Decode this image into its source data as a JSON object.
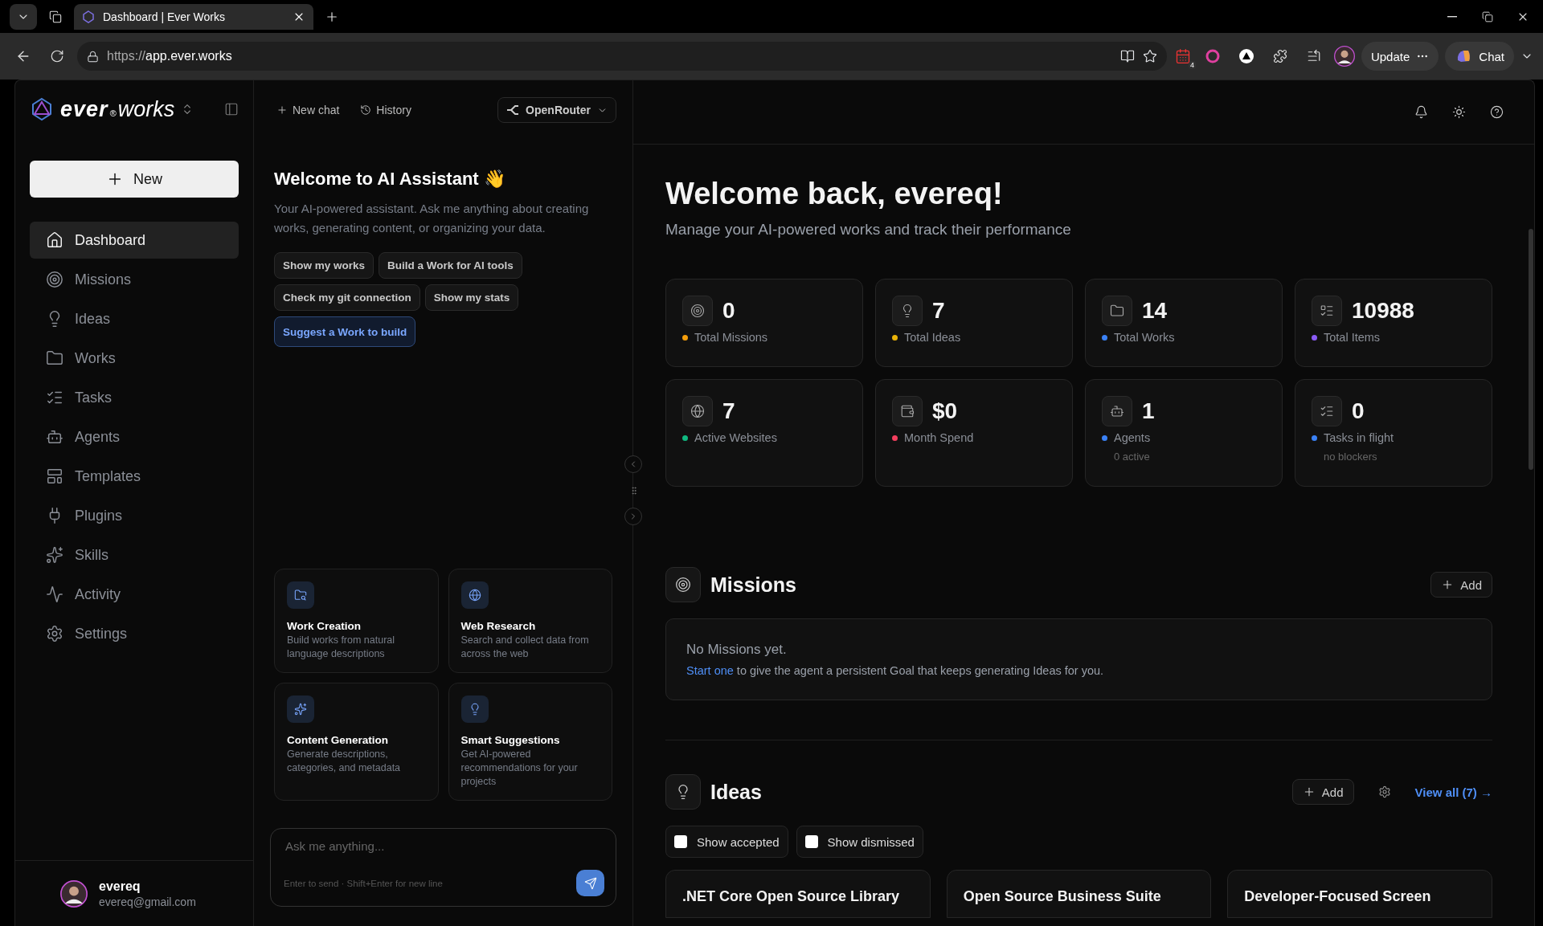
{
  "browser": {
    "tabs": [
      {
        "title": "Dashboard | Ever Works",
        "selected": true
      }
    ],
    "url_scheme": "https://",
    "url_host": "app.ever.works",
    "extension_badge": "4",
    "update_button": "Update",
    "chat_button": "Chat"
  },
  "sidebar": {
    "logo": {
      "word": "ever",
      "mark": "®",
      "suffix": "works"
    },
    "new_button": "New",
    "items": [
      {
        "label": "Dashboard",
        "selected": true
      },
      {
        "label": "Missions",
        "selected": false
      },
      {
        "label": "Ideas",
        "selected": false
      },
      {
        "label": "Works",
        "selected": false
      },
      {
        "label": "Tasks",
        "selected": false
      },
      {
        "label": "Agents",
        "selected": false
      },
      {
        "label": "Templates",
        "selected": false
      },
      {
        "label": "Plugins",
        "selected": false
      },
      {
        "label": "Skills",
        "selected": false
      },
      {
        "label": "Activity",
        "selected": false
      },
      {
        "label": "Settings",
        "selected": false
      }
    ],
    "user": {
      "name": "evereq",
      "email": "evereq@gmail.com"
    }
  },
  "chat": {
    "new_chat": "New chat",
    "history": "History",
    "model": "OpenRouter",
    "title": "Welcome to AI Assistant 👋",
    "intro": "Your AI-powered assistant. Ask me anything about creating works, generating content, or organizing your data.",
    "suggestions": [
      {
        "label": "Show my works",
        "highlighted": false
      },
      {
        "label": "Build a Work for AI tools",
        "highlighted": false
      },
      {
        "label": "Check my git connection",
        "highlighted": false
      },
      {
        "label": "Show my stats",
        "highlighted": false
      },
      {
        "label": "Suggest a Work to build",
        "highlighted": true
      }
    ],
    "features": [
      {
        "title": "Work Creation",
        "description": "Build works from natural language descriptions"
      },
      {
        "title": "Web Research",
        "description": "Search and collect data from across the web"
      },
      {
        "title": "Content Generation",
        "description": "Generate descriptions, categories, and metadata"
      },
      {
        "title": "Smart Suggestions",
        "description": "Get AI-powered recommendations for your projects"
      }
    ],
    "input": {
      "placeholder": "Ask me anything...",
      "hint": "Enter to send · Shift+Enter for new line"
    }
  },
  "main": {
    "heading": "Welcome back, evereq!",
    "subtitle": "Manage your AI-powered works and track their performance",
    "stats": [
      {
        "value": "0",
        "label": "Total Missions",
        "color": "#f59e0b"
      },
      {
        "value": "7",
        "label": "Total Ideas",
        "color": "#eab308"
      },
      {
        "value": "14",
        "label": "Total Works",
        "color": "#3b82f6"
      },
      {
        "value": "10988",
        "label": "Total Items",
        "color": "#8b5cf6"
      },
      {
        "value": "7",
        "label": "Active Websites",
        "color": "#10b981"
      },
      {
        "value": "$0",
        "label": "Month Spend",
        "color": "#f43f5e"
      },
      {
        "value": "1",
        "label": "Agents",
        "color": "#3b82f6",
        "note": "0 active"
      },
      {
        "value": "0",
        "label": "Tasks in flight",
        "color": "#3b82f6",
        "note": "no blockers"
      }
    ],
    "missions": {
      "title": "Missions",
      "add": "Add",
      "empty_title": "No Missions yet.",
      "empty_link": "Start one",
      "empty_text": " to give the agent a persistent Goal that keeps generating Ideas for you."
    },
    "ideas": {
      "title": "Ideas",
      "add": "Add",
      "view_all": "View all (7) →",
      "filters": [
        {
          "label": "Show accepted",
          "checked": false
        },
        {
          "label": "Show dismissed",
          "checked": false
        }
      ],
      "cards": [
        {
          "title": ".NET Core Open Source Library"
        },
        {
          "title": "Open Source Business Suite"
        },
        {
          "title": "Developer-Focused Screen"
        }
      ]
    }
  }
}
